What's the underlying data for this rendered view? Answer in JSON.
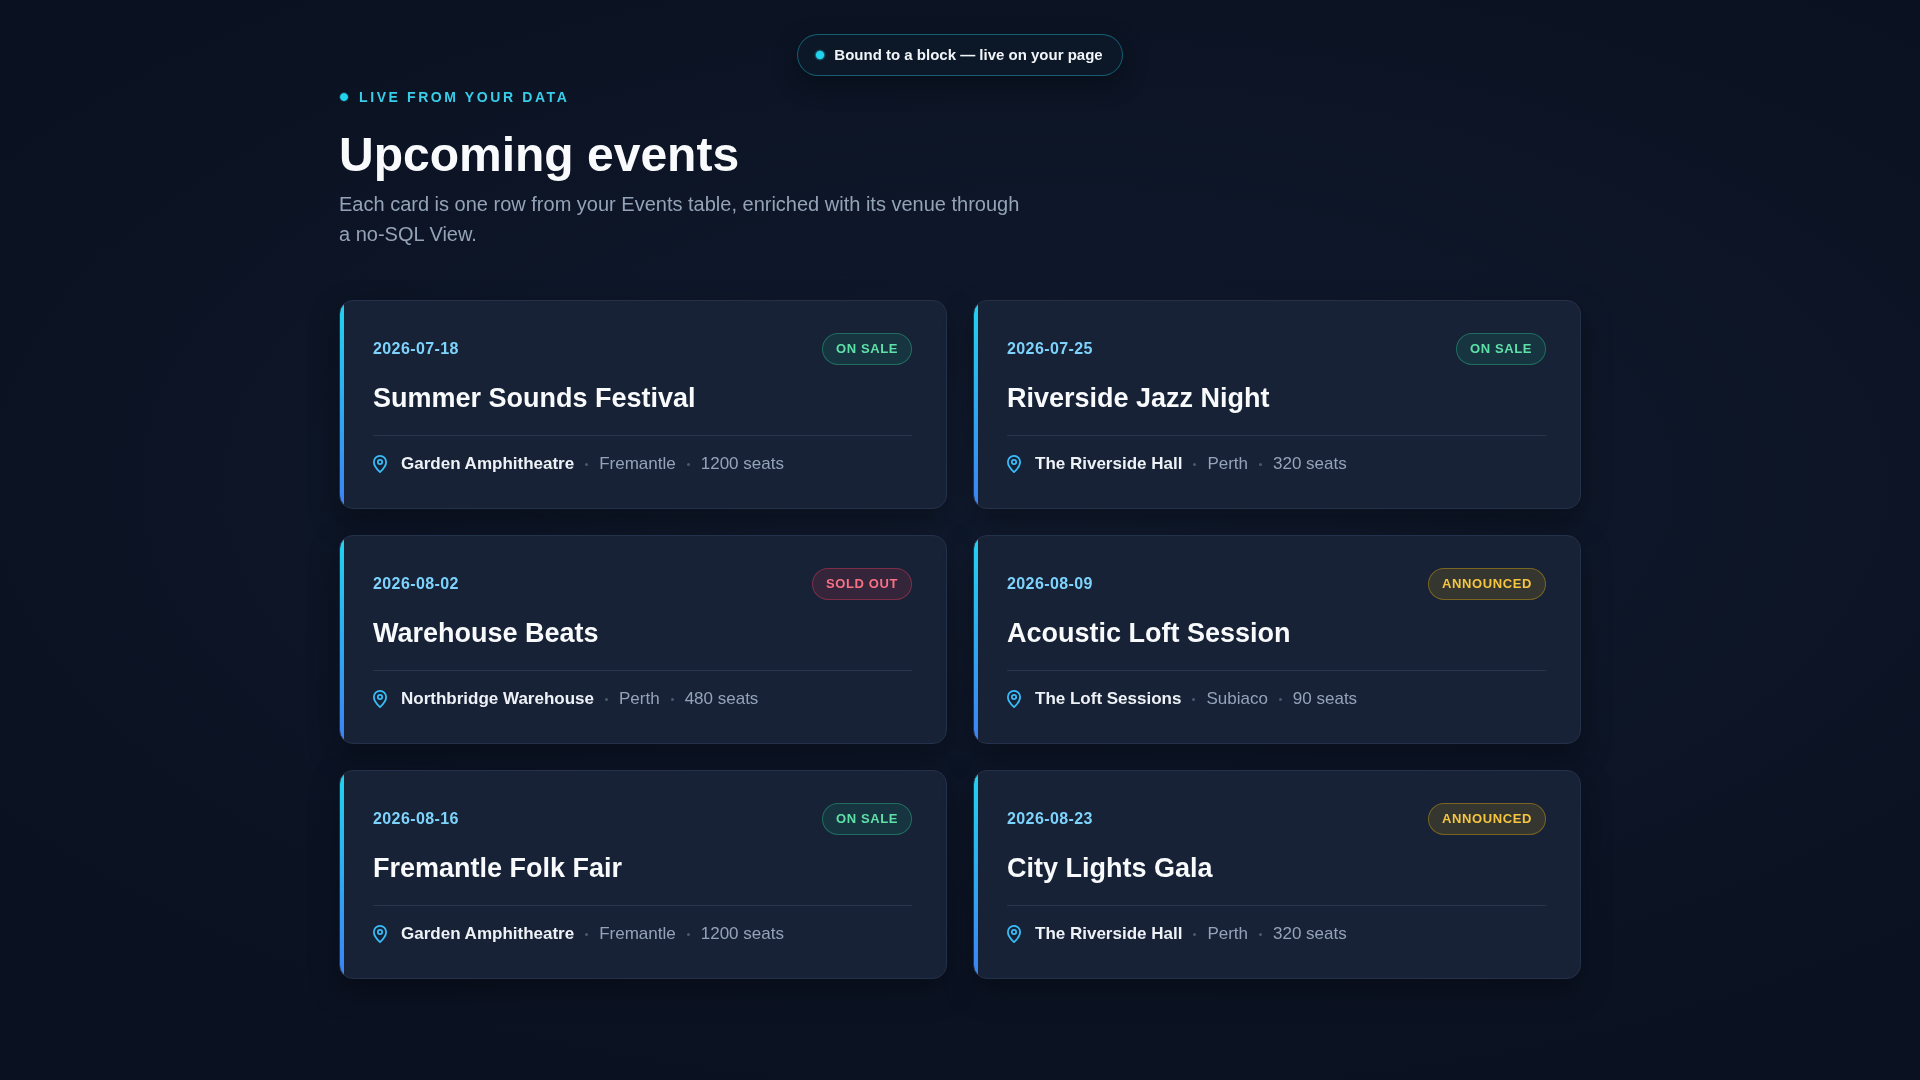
{
  "banner": {
    "text": "Bound to a block — live on your page"
  },
  "header": {
    "eyebrow": "LIVE FROM YOUR DATA",
    "title": "Upcoming events",
    "subtitle": "Each card is one row from your Events table, enriched with its venue through a no-SQL View."
  },
  "events": [
    {
      "date": "2026-07-18",
      "status": {
        "kind": "on_sale",
        "label": "ON SALE"
      },
      "title": "Summer Sounds Festival",
      "venue": "Garden Amphitheatre",
      "city": "Fremantle",
      "seats": "1200 seats"
    },
    {
      "date": "2026-07-25",
      "status": {
        "kind": "on_sale",
        "label": "ON SALE"
      },
      "title": "Riverside Jazz Night",
      "venue": "The Riverside Hall",
      "city": "Perth",
      "seats": "320 seats"
    },
    {
      "date": "2026-08-02",
      "status": {
        "kind": "sold_out",
        "label": "SOLD OUT"
      },
      "title": "Warehouse Beats",
      "venue": "Northbridge Warehouse",
      "city": "Perth",
      "seats": "480 seats"
    },
    {
      "date": "2026-08-09",
      "status": {
        "kind": "announced",
        "label": "ANNOUNCED"
      },
      "title": "Acoustic Loft Session",
      "venue": "The Loft Sessions",
      "city": "Subiaco",
      "seats": "90 seats"
    },
    {
      "date": "2026-08-16",
      "status": {
        "kind": "on_sale",
        "label": "ON SALE"
      },
      "title": "Fremantle Folk Fair",
      "venue": "Garden Amphitheatre",
      "city": "Fremantle",
      "seats": "1200 seats"
    },
    {
      "date": "2026-08-23",
      "status": {
        "kind": "announced",
        "label": "ANNOUNCED"
      },
      "title": "City Lights Gala",
      "venue": "The Riverside Hall",
      "city": "Perth",
      "seats": "320 seats"
    }
  ]
}
